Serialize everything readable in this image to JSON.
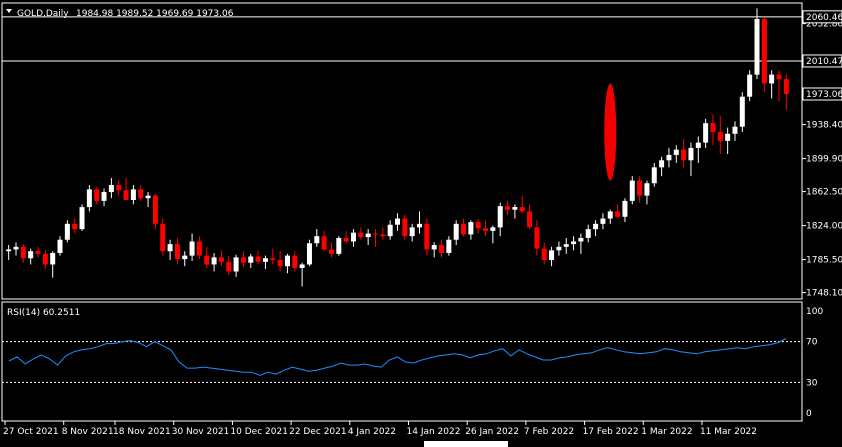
{
  "header": {
    "symbol": "GOLD,Daily",
    "ohlc": "1984.98 1989.52 1969.69 1973.06",
    "rsi_label": "RSI(14) 60.2511"
  },
  "colors": {
    "background": "#000000",
    "up": "#ffffff",
    "down": "#ff0000",
    "rsi_line": "#1e90ff",
    "grid": "#ffffff"
  },
  "chart_data": [
    {
      "type": "candlestick",
      "title": "GOLD,Daily",
      "ylim": [
        1742,
        2075
      ],
      "y_ticks": [
        1748.1,
        1785.5,
        1824.0,
        1862.5,
        1899.9,
        1938.4,
        1973.06,
        2010.47,
        2052.8,
        2060.46
      ],
      "y_tick_labels": [
        "1748.10",
        "1785.50",
        "1824.00",
        "1862.50",
        "1899.90",
        "1938.40",
        "1973.06",
        "2010.47",
        "2052.80",
        "2060.46"
      ],
      "horizontal_lines": [
        2060.46,
        2010.47
      ],
      "highlighted_values": [
        2060.46,
        2010.47,
        1973.06
      ],
      "x_tick_labels": [
        "27 Oct 2021",
        "8 Nov 2021",
        "18 Nov 2021",
        "30 Nov 2021",
        "10 Dec 2021",
        "22 Dec 2021",
        "4 Jan 2022",
        "14 Jan 2022",
        "26 Jan 2022",
        "7 Feb 2022",
        "17 Feb 2022",
        "1 Mar 2022",
        "11 Mar 2022"
      ],
      "x_tick_index": [
        0,
        8,
        15,
        23,
        31,
        39,
        47,
        55,
        63,
        71,
        79,
        87,
        95
      ],
      "annotation": "red ellipse marker around 17 Feb 2022 candles",
      "annotation_index": 82,
      "candles": [
        [
          1795,
          1802,
          1785,
          1797
        ],
        [
          1797,
          1805,
          1790,
          1800
        ],
        [
          1800,
          1803,
          1782,
          1787
        ],
        [
          1787,
          1798,
          1780,
          1795
        ],
        [
          1795,
          1800,
          1788,
          1792
        ],
        [
          1792,
          1796,
          1775,
          1780
        ],
        [
          1780,
          1795,
          1765,
          1793
        ],
        [
          1793,
          1812,
          1790,
          1808
        ],
        [
          1808,
          1830,
          1805,
          1826
        ],
        [
          1826,
          1832,
          1815,
          1820
        ],
        [
          1820,
          1848,
          1818,
          1845
        ],
        [
          1845,
          1870,
          1840,
          1865
        ],
        [
          1865,
          1868,
          1848,
          1852
        ],
        [
          1852,
          1866,
          1846,
          1862
        ],
        [
          1862,
          1878,
          1855,
          1870
        ],
        [
          1870,
          1875,
          1858,
          1864
        ],
        [
          1864,
          1878,
          1858,
          1853
        ],
        [
          1853,
          1870,
          1848,
          1865
        ],
        [
          1865,
          1870,
          1852,
          1855
        ],
        [
          1855,
          1862,
          1845,
          1858
        ],
        [
          1858,
          1860,
          1820,
          1826
        ],
        [
          1826,
          1832,
          1790,
          1795
        ],
        [
          1795,
          1808,
          1785,
          1803
        ],
        [
          1803,
          1810,
          1780,
          1786
        ],
        [
          1786,
          1795,
          1778,
          1790
        ],
        [
          1790,
          1815,
          1784,
          1806
        ],
        [
          1806,
          1812,
          1786,
          1790
        ],
        [
          1790,
          1800,
          1776,
          1780
        ],
        [
          1780,
          1793,
          1772,
          1788
        ],
        [
          1788,
          1796,
          1778,
          1783
        ],
        [
          1783,
          1790,
          1768,
          1772
        ],
        [
          1772,
          1791,
          1766,
          1788
        ],
        [
          1788,
          1795,
          1777,
          1782
        ],
        [
          1782,
          1792,
          1776,
          1789
        ],
        [
          1789,
          1796,
          1780,
          1783
        ],
        [
          1783,
          1790,
          1775,
          1787
        ],
        [
          1787,
          1798,
          1780,
          1785
        ],
        [
          1785,
          1795,
          1772,
          1778
        ],
        [
          1778,
          1792,
          1770,
          1790
        ],
        [
          1790,
          1795,
          1772,
          1776
        ],
        [
          1776,
          1782,
          1755,
          1780
        ],
        [
          1780,
          1808,
          1778,
          1804
        ],
        [
          1804,
          1820,
          1800,
          1812
        ],
        [
          1812,
          1818,
          1795,
          1797
        ],
        [
          1797,
          1805,
          1788,
          1792
        ],
        [
          1792,
          1812,
          1790,
          1810
        ],
        [
          1810,
          1818,
          1804,
          1806
        ],
        [
          1806,
          1820,
          1800,
          1816
        ],
        [
          1816,
          1822,
          1808,
          1811
        ],
        [
          1811,
          1820,
          1802,
          1815
        ],
        [
          1815,
          1820,
          1800,
          1814
        ],
        [
          1814,
          1822,
          1808,
          1812
        ],
        [
          1812,
          1830,
          1808,
          1825
        ],
        [
          1825,
          1838,
          1818,
          1832
        ],
        [
          1832,
          1836,
          1808,
          1812
        ],
        [
          1812,
          1826,
          1806,
          1822
        ],
        [
          1822,
          1840,
          1815,
          1826
        ],
        [
          1826,
          1832,
          1790,
          1797
        ],
        [
          1797,
          1805,
          1788,
          1802
        ],
        [
          1802,
          1808,
          1788,
          1793
        ],
        [
          1793,
          1812,
          1790,
          1808
        ],
        [
          1808,
          1830,
          1802,
          1826
        ],
        [
          1826,
          1832,
          1812,
          1814
        ],
        [
          1814,
          1830,
          1808,
          1828
        ],
        [
          1828,
          1832,
          1815,
          1821
        ],
        [
          1821,
          1830,
          1812,
          1818
        ],
        [
          1818,
          1824,
          1804,
          1822
        ],
        [
          1822,
          1850,
          1812,
          1846
        ],
        [
          1846,
          1852,
          1836,
          1842
        ],
        [
          1842,
          1848,
          1832,
          1845
        ],
        [
          1845,
          1858,
          1838,
          1840
        ],
        [
          1840,
          1848,
          1820,
          1822
        ],
        [
          1822,
          1830,
          1790,
          1798
        ],
        [
          1798,
          1805,
          1780,
          1785
        ],
        [
          1785,
          1800,
          1778,
          1796
        ],
        [
          1796,
          1806,
          1790,
          1800
        ],
        [
          1800,
          1810,
          1792,
          1803
        ],
        [
          1803,
          1812,
          1796,
          1806
        ],
        [
          1806,
          1815,
          1792,
          1810
        ],
        [
          1810,
          1825,
          1805,
          1820
        ],
        [
          1820,
          1830,
          1812,
          1826
        ],
        [
          1826,
          1838,
          1820,
          1832
        ],
        [
          1832,
          1842,
          1826,
          1840
        ],
        [
          1840,
          1848,
          1832,
          1834
        ],
        [
          1834,
          1855,
          1828,
          1852
        ],
        [
          1852,
          1880,
          1848,
          1875
        ],
        [
          1875,
          1880,
          1850,
          1858
        ],
        [
          1858,
          1875,
          1848,
          1872
        ],
        [
          1872,
          1895,
          1868,
          1890
        ],
        [
          1890,
          1902,
          1880,
          1898
        ],
        [
          1898,
          1912,
          1890,
          1904
        ],
        [
          1904,
          1915,
          1895,
          1910
        ],
        [
          1910,
          1922,
          1890,
          1898
        ],
        [
          1898,
          1918,
          1880,
          1912
        ],
        [
          1912,
          1925,
          1895,
          1918
        ],
        [
          1918,
          1945,
          1912,
          1940
        ],
        [
          1940,
          1950,
          1915,
          1930
        ],
        [
          1930,
          1948,
          1905,
          1920
        ],
        [
          1920,
          1935,
          1905,
          1928
        ],
        [
          1928,
          1942,
          1920,
          1936
        ],
        [
          1936,
          1975,
          1930,
          1970
        ],
        [
          1970,
          2000,
          1965,
          1995
        ],
        [
          1995,
          2070,
          1990,
          2058
        ],
        [
          2058,
          2060,
          1975,
          1985
        ],
        [
          1985,
          2000,
          1968,
          1995
        ],
        [
          1995,
          2000,
          1965,
          1990
        ],
        [
          1990,
          1995,
          1955,
          1973
        ]
      ]
    },
    {
      "type": "line",
      "title": "RSI(14) 60.2511",
      "ylim": [
        0,
        100
      ],
      "y_ticks": [
        100,
        70,
        30,
        0
      ],
      "levels": [
        70,
        30
      ],
      "values": [
        51,
        55,
        48,
        53,
        57,
        53,
        47,
        56,
        60,
        62,
        63,
        65,
        68,
        68,
        70,
        71,
        69,
        65,
        70,
        66,
        62,
        50,
        44,
        44,
        45,
        44,
        43,
        42,
        41,
        40,
        40,
        37,
        40,
        38,
        42,
        45,
        43,
        41,
        42,
        44,
        46,
        49,
        47,
        47,
        48,
        46,
        45,
        52,
        55,
        50,
        49,
        52,
        54,
        56,
        57,
        58,
        57,
        54,
        57,
        58,
        61,
        63,
        56,
        62,
        58,
        55,
        52,
        52,
        54,
        55,
        57,
        58,
        59,
        62,
        64,
        62,
        60,
        59,
        58,
        59,
        60,
        63,
        62,
        60,
        59,
        58,
        60,
        61,
        62,
        63,
        64,
        63,
        65,
        66,
        67,
        69,
        73
      ]
    }
  ]
}
